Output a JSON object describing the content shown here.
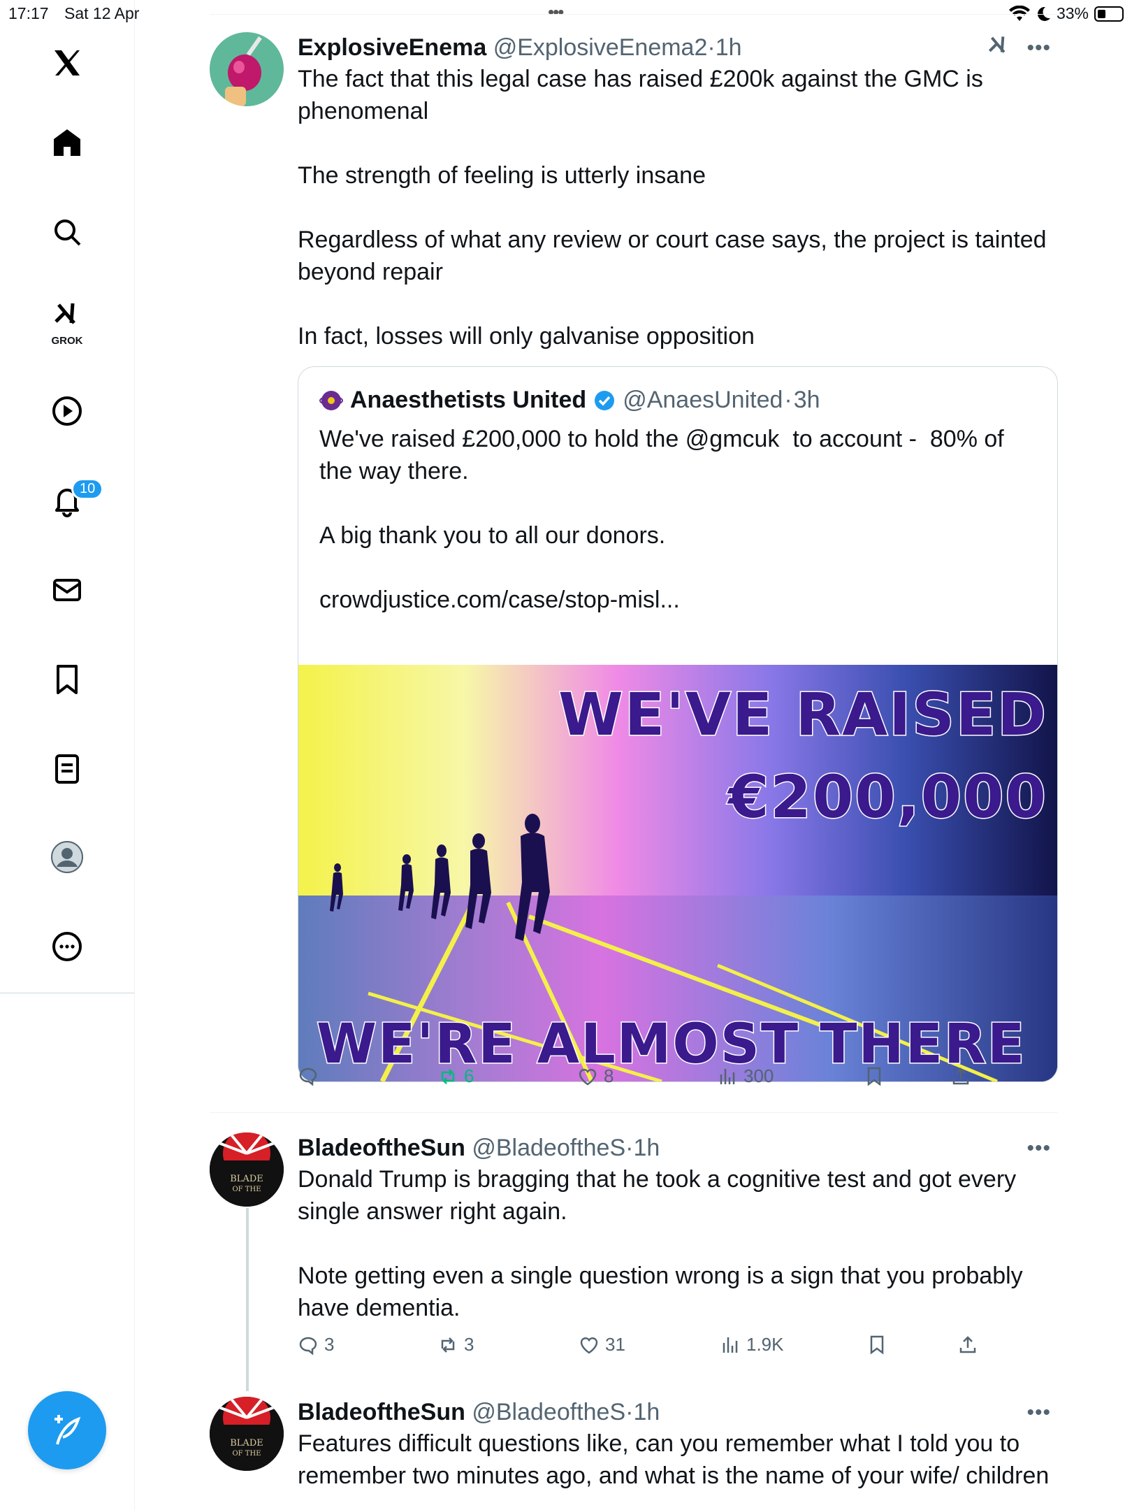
{
  "status_bar": {
    "time": "17:17",
    "date": "Sat 12 Apr",
    "battery": "33%",
    "battery_level": 0.33
  },
  "sidebar": {
    "logo": "x-logo-icon",
    "items": [
      {
        "icon": "home-icon"
      },
      {
        "icon": "search-icon"
      },
      {
        "icon": "grok-icon",
        "label": "GROK"
      },
      {
        "icon": "video-icon"
      },
      {
        "icon": "bell-icon",
        "badge": "10"
      },
      {
        "icon": "mail-icon"
      },
      {
        "icon": "bookmark-icon"
      },
      {
        "icon": "list-icon"
      },
      {
        "icon": "profile-icon"
      },
      {
        "icon": "more-icon"
      }
    ]
  },
  "tweets": [
    {
      "name": "ExplosiveEnema",
      "handle": "@ExplosiveEnema2",
      "sep": "·",
      "time": "1h",
      "text": "The fact that this legal case has raised £200k against the GMC is phenomenal\n\nThe strength of feeling is utterly insane\n\nRegardless of what any review or court case says, the project is tainted beyond repair\n\nIn fact, losses will only galvanise opposition",
      "quote": {
        "name": "Anaesthetists United",
        "handle": "@AnaesUnited",
        "sep": "·",
        "time": "3h",
        "text": "We've raised £200,000 to hold the @gmcuk  to account -  80% of the way there.\n\nA big thank you to all our donors.\n\ncrowdjustice.com/case/stop-misl...",
        "image_text": {
          "line1": "WE'VE RAISED",
          "line2": "€200,000",
          "line3": "WE'RE ALMOST  THERE"
        }
      },
      "actions": {
        "replies": "",
        "reposts": "6",
        "likes": "8",
        "views": "300"
      }
    },
    {
      "name": "BladeoftheSun",
      "handle": "@BladeoftheS",
      "sep": "·",
      "time": "1h",
      "text": "Donald Trump is bragging that he took a cognitive test and got every single answer right again.\n\nNote getting even a single question wrong is a sign that you probably have dementia.",
      "actions": {
        "replies": "3",
        "reposts": "3",
        "likes": "31",
        "views": "1.9K"
      }
    },
    {
      "name": "BladeoftheSun",
      "handle": "@BladeoftheS",
      "sep": "·",
      "time": "1h",
      "text": "Features difficult questions like, can you remember what I told you to remember two minutes ago, and what is the name of your wife/ children"
    }
  ],
  "colors": {
    "accent": "#1d9bf0",
    "repost_green": "#00ba7c",
    "muted": "#536471"
  }
}
